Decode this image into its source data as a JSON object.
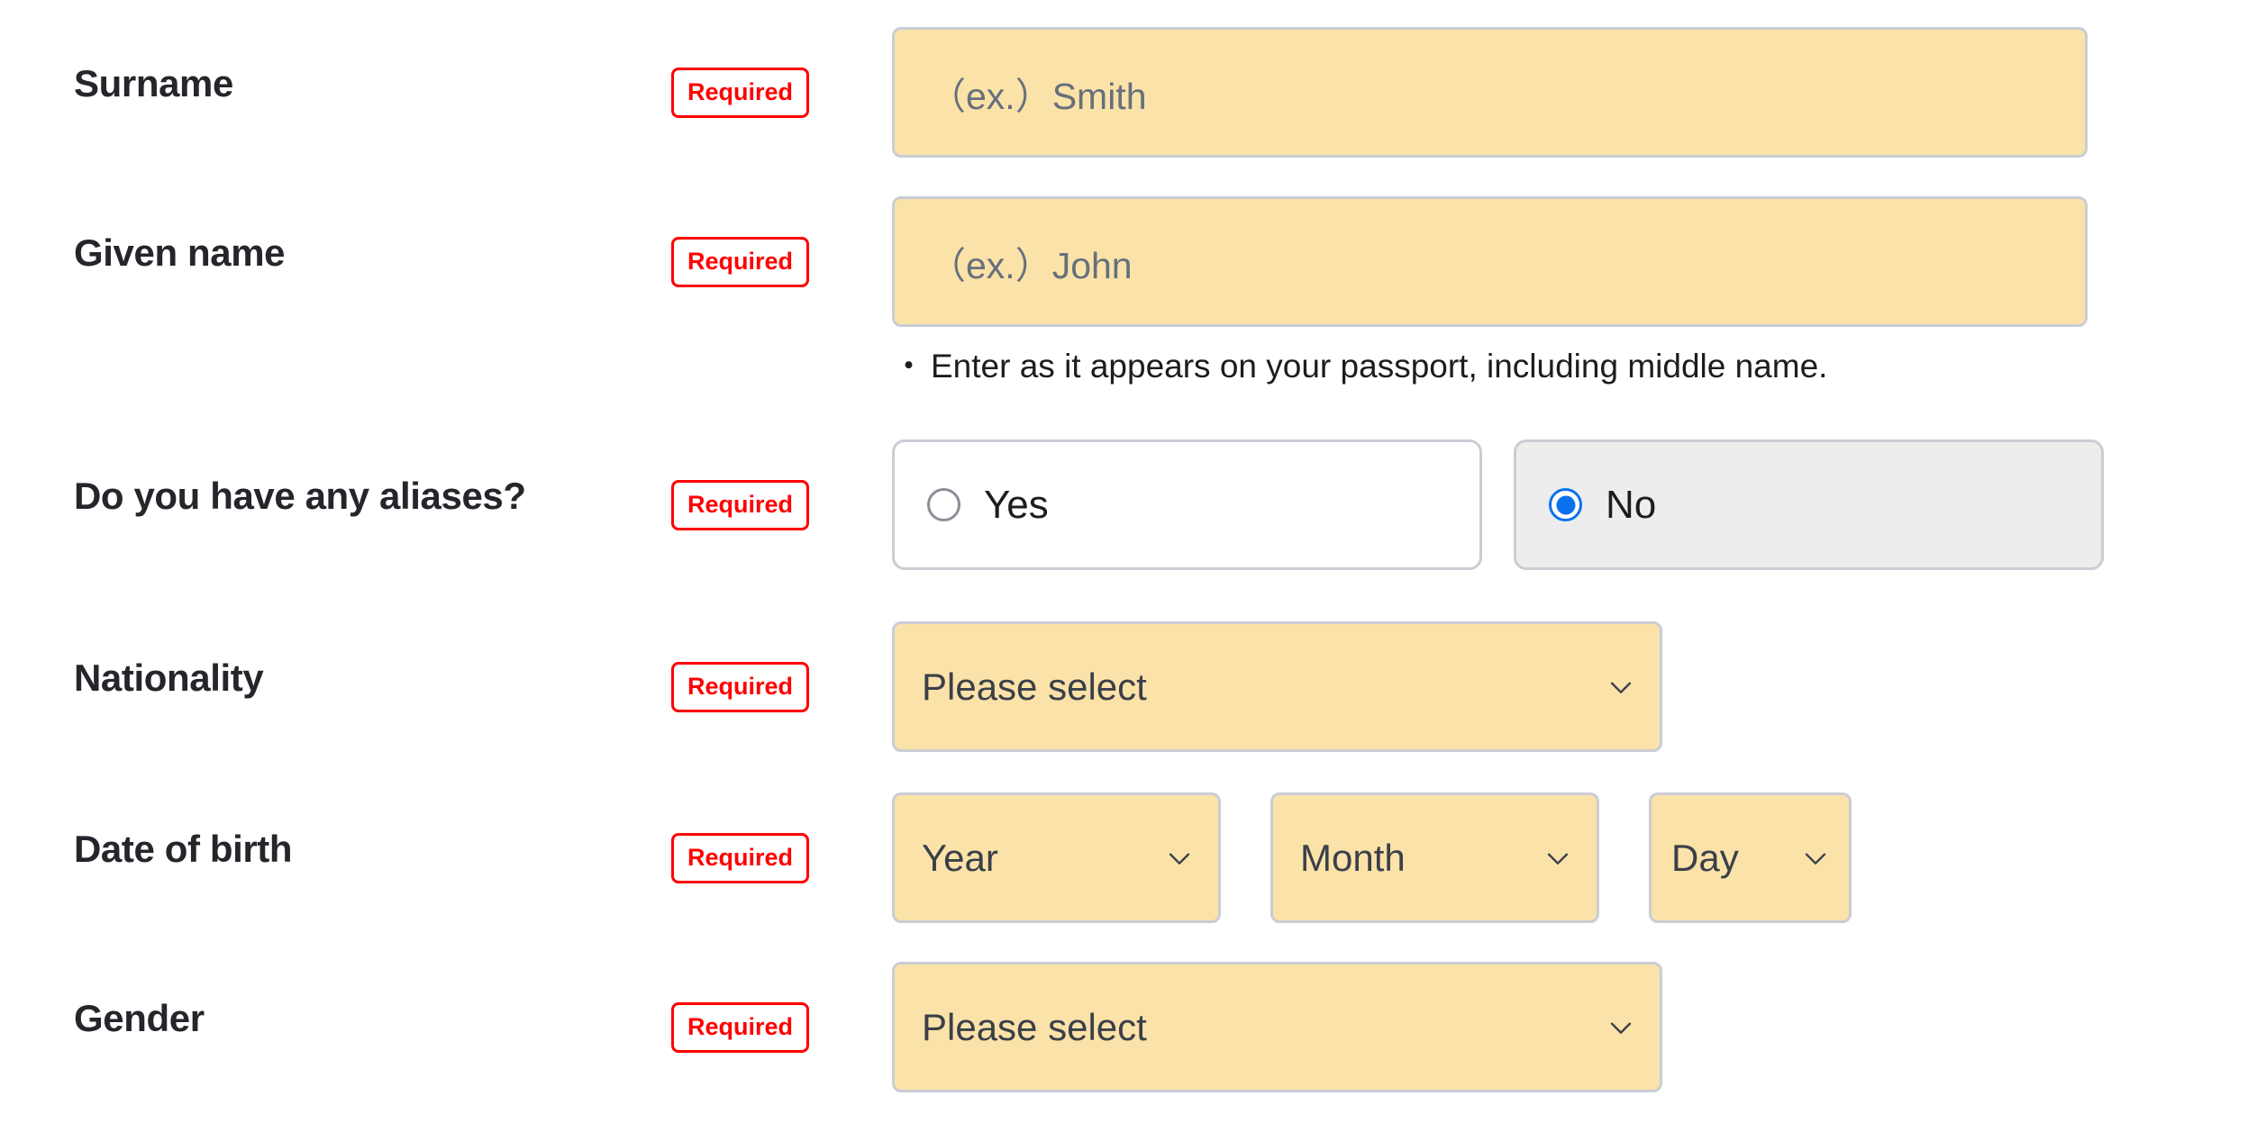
{
  "form": {
    "required_badge_label": "Required",
    "rows": [
      {
        "id": "surname",
        "label": "Surname",
        "required": "Required",
        "control": "text",
        "placeholder": "（ex.）Smith"
      },
      {
        "id": "given-name",
        "label": "Given name",
        "required": "Required",
        "control": "text",
        "placeholder": "（ex.）John",
        "hint_bullet": "・",
        "hint": "Enter as it appears on your passport, including middle name."
      },
      {
        "id": "aliases",
        "label": "Do you have any aliases?",
        "required": "Required",
        "control": "radio",
        "options": [
          {
            "label": "Yes",
            "selected": false
          },
          {
            "label": "No",
            "selected": true
          }
        ]
      },
      {
        "id": "nationality",
        "label": "Nationality",
        "required": "Required",
        "control": "select",
        "value": "Please select"
      },
      {
        "id": "date-of-birth",
        "label": "Date of birth",
        "required": "Required",
        "control": "select-group",
        "selects": [
          {
            "name": "year",
            "value": "Year"
          },
          {
            "name": "month",
            "value": "Month"
          },
          {
            "name": "day",
            "value": "Day"
          }
        ]
      },
      {
        "id": "gender",
        "label": "Gender",
        "required": "Required",
        "control": "select",
        "value": "Please select"
      }
    ]
  },
  "colors": {
    "field_background": "#fbe2a8",
    "field_border": "#c9cdd4",
    "required_red": "#ff0000",
    "radio_selected_blue": "#0b72ef",
    "radio_selected_background": "#ededed",
    "label_text": "#24262b",
    "placeholder_text": "#66707c"
  }
}
